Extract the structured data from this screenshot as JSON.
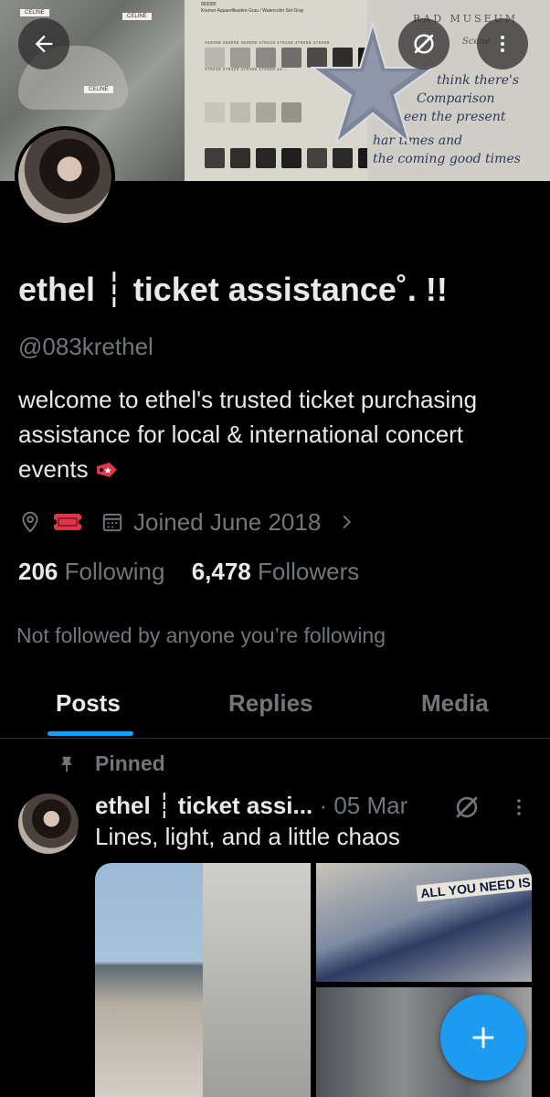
{
  "banner": {
    "sweater_tags": [
      "CELINE",
      "CELINE",
      "CELINE"
    ],
    "palette_header": [
      "883085",
      "Kremer Aquarellkasten Grau / Watercolor Set Gray"
    ],
    "palette_codes_row1": "462008 463008 463608 479218 479228 479258 479268",
    "palette_codes_row2": "479418 479428 479458 479468 12...",
    "note_lines": [
      "RAD MUSEUM",
      "Scene",
      "think there's",
      "Comparison",
      "een the present",
      "har times and",
      "the coming good times"
    ]
  },
  "header_buttons": {
    "back_icon": "arrow-left-icon",
    "grok_icon": "slash-circle-icon",
    "more_icon": "more-vertical-icon"
  },
  "profile": {
    "display_name": "ethel ┆ ticket assistance˚. !!",
    "handle": "@083krethel",
    "bio": "welcome to ethel's trusted ticket purchasing assistance for local & international concert events",
    "bio_emoji": "ticket-tag-emoji",
    "joined": "Joined June 2018",
    "following_count": "206",
    "following_label": "Following",
    "followers_count": "6,478",
    "followers_label": "Followers",
    "not_followed_text": "Not followed by anyone you’re following"
  },
  "tabs": [
    {
      "label": "Posts",
      "active": true
    },
    {
      "label": "Replies",
      "active": false
    },
    {
      "label": "Media",
      "active": false
    }
  ],
  "pinned_post": {
    "pinned_label": "Pinned",
    "author_name": "ethel ┆ ticket assi...",
    "separator": "·",
    "date": "05 Mar",
    "text": "Lines, light, and a little chaos",
    "media_caption": "ALL YOU NEED IS"
  },
  "colors": {
    "accent": "#1d9bf0",
    "text_primary": "#e7e9ea",
    "text_secondary": "#71767b",
    "ticket_red": "#e0344a"
  }
}
